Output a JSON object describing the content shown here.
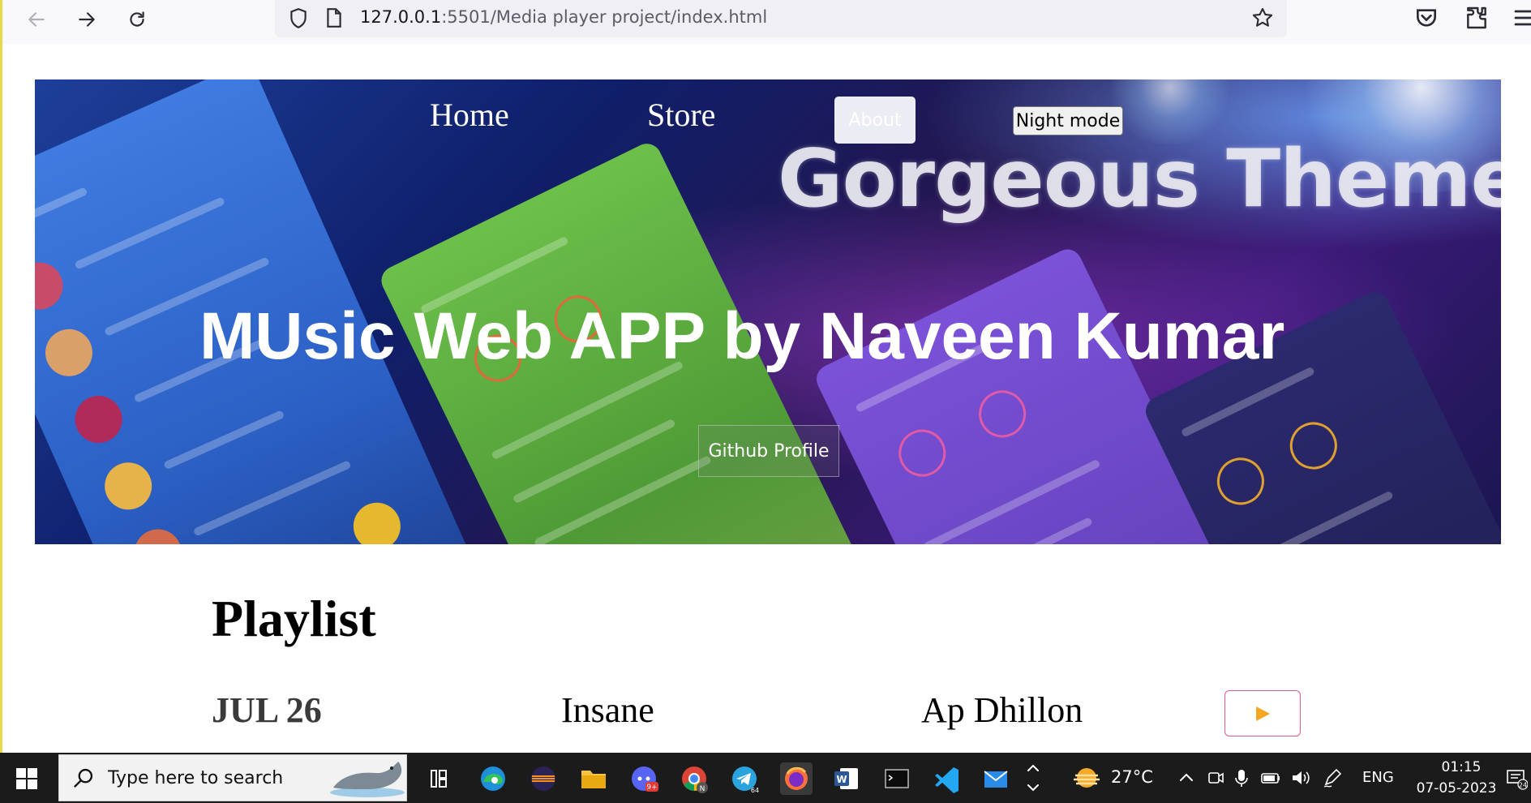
{
  "browser": {
    "url_host": "127.0.0.1",
    "url_path": ":5501/Media player project/index.html"
  },
  "nav": {
    "home": "Home",
    "store": "Store",
    "about": "About",
    "night_mode": "Night mode"
  },
  "hero": {
    "banner_text": "Gorgeous Theme",
    "title": "MUsic Web APP by Naveen Kumar",
    "github_label": "Github Profile"
  },
  "playlist": {
    "heading": "Playlist",
    "tracks": [
      {
        "date": "JUL 26",
        "title": "Insane",
        "artist": "Ap Dhillon",
        "play_icon": "play-triangle-icon"
      }
    ]
  },
  "taskbar": {
    "search_placeholder": "Type here to search",
    "temperature": "27°C",
    "language": "ENG",
    "time": "01:15",
    "date": "07-05-2023",
    "notification_count": "24"
  },
  "colors": {
    "play_icon": "#f5a623",
    "play_border": "#e05a8a",
    "page_border": "#e8d84a"
  }
}
